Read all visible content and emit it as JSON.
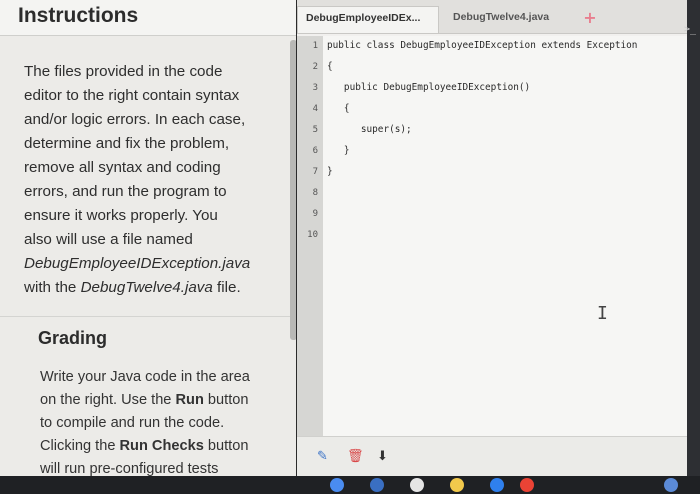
{
  "instructions": {
    "title": "Instructions",
    "body_lines": [
      "The files provided in the code",
      "editor to the right contain syntax",
      "and/or logic errors. In each case,",
      "determine and fix the problem,",
      "remove all syntax and coding",
      "errors, and run the program to",
      "ensure it works properly. You",
      "also will use a file named"
    ],
    "file_name_line": "DebugEmployeeIDException.java",
    "with_prefix": "with the ",
    "with_file": "DebugTwelve4.java",
    "with_suffix": " file."
  },
  "grading": {
    "title": "Grading",
    "line1": "Write your Java code in the area",
    "line2": "on the right. Use the ",
    "run_label": "Run",
    "line2_end": " button",
    "line3": "to compile and run the code.",
    "line4_pre": "Clicking the ",
    "run_checks_label": "Run Checks",
    "line4_end": " button",
    "line5": "will run pre-configured tests"
  },
  "editor": {
    "tabs": [
      {
        "label": "DebugEmployeeIDEx...",
        "active": true
      },
      {
        "label": "DebugTwelve4.java",
        "active": false
      }
    ],
    "add_tab_label": "+",
    "line_numbers": [
      "1",
      "2",
      "3",
      "4",
      "5",
      "6",
      "7",
      "8",
      "9",
      "10"
    ],
    "code_lines": [
      "public class DebugEmployeeIDException extends Exception",
      "{",
      "   public DebugEmployeeIDException()",
      "   {",
      "      super(s);",
      "   }",
      "}",
      "",
      "",
      ""
    ]
  },
  "colors": {
    "accent_pink": "#e87f8f",
    "pencil_blue": "#3b73c7",
    "trash_red": "#d94848"
  },
  "icons": {
    "pencil": "pencil-icon",
    "trash": "trash-icon",
    "download": "download-icon",
    "terminal": "terminal-icon"
  },
  "terminal_glyph": ">_"
}
